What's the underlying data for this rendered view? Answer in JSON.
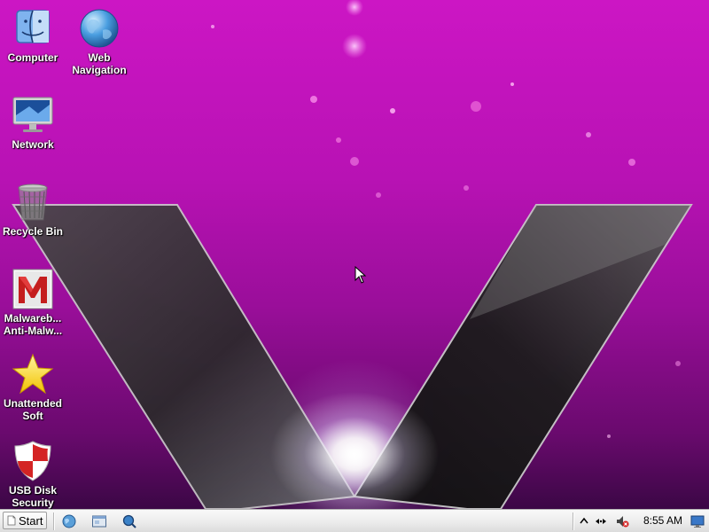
{
  "desktop": {
    "icons": [
      {
        "label": "Computer",
        "icon": "finder-face-icon"
      },
      {
        "label": "Web\nNavigation",
        "icon": "globe-icon"
      },
      {
        "label": "Network",
        "icon": "monitor-icon"
      },
      {
        "label": "Recycle Bin",
        "icon": "trash-can-icon"
      },
      {
        "label": "Malwareb...\nAnti-Malw...",
        "icon": "malwarebytes-logo-icon"
      },
      {
        "label": "Unattended\nSoft",
        "icon": "star-icon"
      },
      {
        "label": "USB Disk\nSecurity",
        "icon": "shield-icon"
      }
    ]
  },
  "taskbar": {
    "start_label": "Start",
    "quick_launch": [
      "globe-icon",
      "folder-window-icon",
      "magnifier-globe-icon"
    ],
    "tray": {
      "icons": [
        "chevron-up-icon",
        "network-arrows-icon",
        "speaker-muted-icon",
        "desktop-icon"
      ],
      "clock": "8:55 AM"
    }
  },
  "colors": {
    "wallpaper_top": "#cc16c4",
    "wallpaper_bottom": "#3b0745",
    "taskbar": "#ececec"
  }
}
